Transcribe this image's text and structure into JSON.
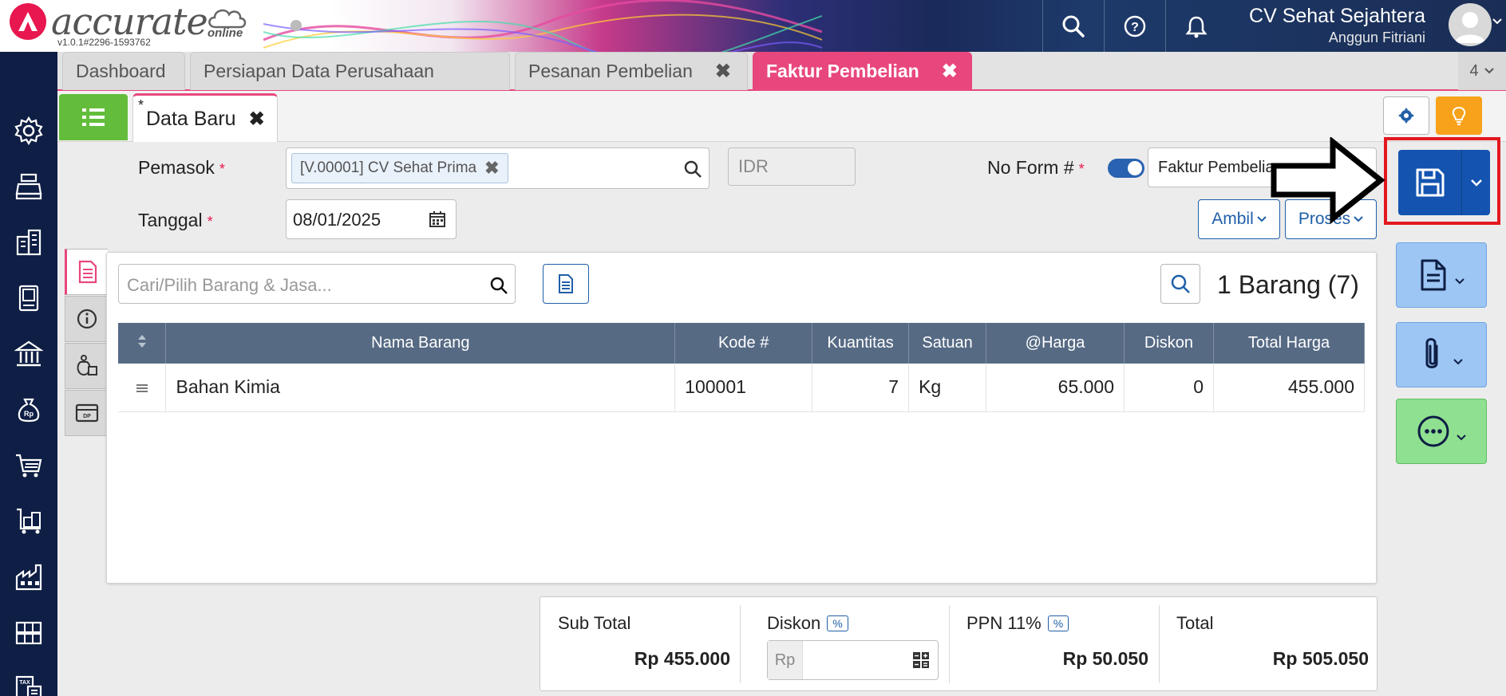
{
  "header": {
    "logo_text": "accurate",
    "logo_sub": "online",
    "version": "v1.0.1#2296-1593762",
    "company": "CV Sehat Sejahtera",
    "user": "Anggun Fitriani",
    "colors": {
      "brand": "#e8174f",
      "sidebar": "#0e1e44",
      "accent_tab": "#e8477d"
    }
  },
  "sidebar": {
    "items": [
      {
        "icon": "gear-icon"
      },
      {
        "icon": "cash-register-icon"
      },
      {
        "icon": "building-icon"
      },
      {
        "icon": "ledger-book-icon"
      },
      {
        "icon": "bank-icon"
      },
      {
        "icon": "money-bag-icon"
      },
      {
        "icon": "shopping-cart-icon"
      },
      {
        "icon": "trolley-boxes-icon"
      },
      {
        "icon": "factory-icon"
      },
      {
        "icon": "warehouse-icon"
      },
      {
        "icon": "tax-document-icon"
      }
    ]
  },
  "tabs": {
    "items": [
      {
        "label": "Dashboard"
      },
      {
        "label": "Persiapan Data Perusahaan"
      },
      {
        "label": "Pesanan Pembelian"
      },
      {
        "label": "Faktur Pembelian"
      }
    ],
    "count": "4"
  },
  "subtab": {
    "star": "*",
    "label": "Data Baru"
  },
  "form": {
    "pemasok_label": "Pemasok",
    "pemasok_value": "[V.00001] CV Sehat Prima",
    "currency_placeholder": "IDR",
    "no_form_label": "No Form #",
    "no_form_value": "Faktur Pembelian",
    "tanggal_label": "Tanggal",
    "tanggal_value": "08/01/2025",
    "required_mark": "*",
    "ambil_label": "Ambil",
    "proses_label": "Proses"
  },
  "items_panel": {
    "search_placeholder": "Cari/Pilih Barang & Jasa...",
    "count_label": "1 Barang (7)",
    "columns": [
      "Nama Barang",
      "Kode #",
      "Kuantitas",
      "Satuan",
      "@Harga",
      "Diskon",
      "Total Harga"
    ],
    "rows": [
      {
        "nama": "Bahan Kimia",
        "kode": "100001",
        "qty": "7",
        "satuan": "Kg",
        "harga": "65.000",
        "diskon": "0",
        "total": "455.000"
      }
    ]
  },
  "totals": {
    "subtotal_label": "Sub Total",
    "subtotal_value": "Rp 455.000",
    "diskon_label": "Diskon",
    "pct": "%",
    "diskon_prefix": "Rp",
    "ppn_label": "PPN 11%",
    "ppn_value": "Rp 50.050",
    "total_label": "Total",
    "total_value": "Rp 505.050"
  }
}
